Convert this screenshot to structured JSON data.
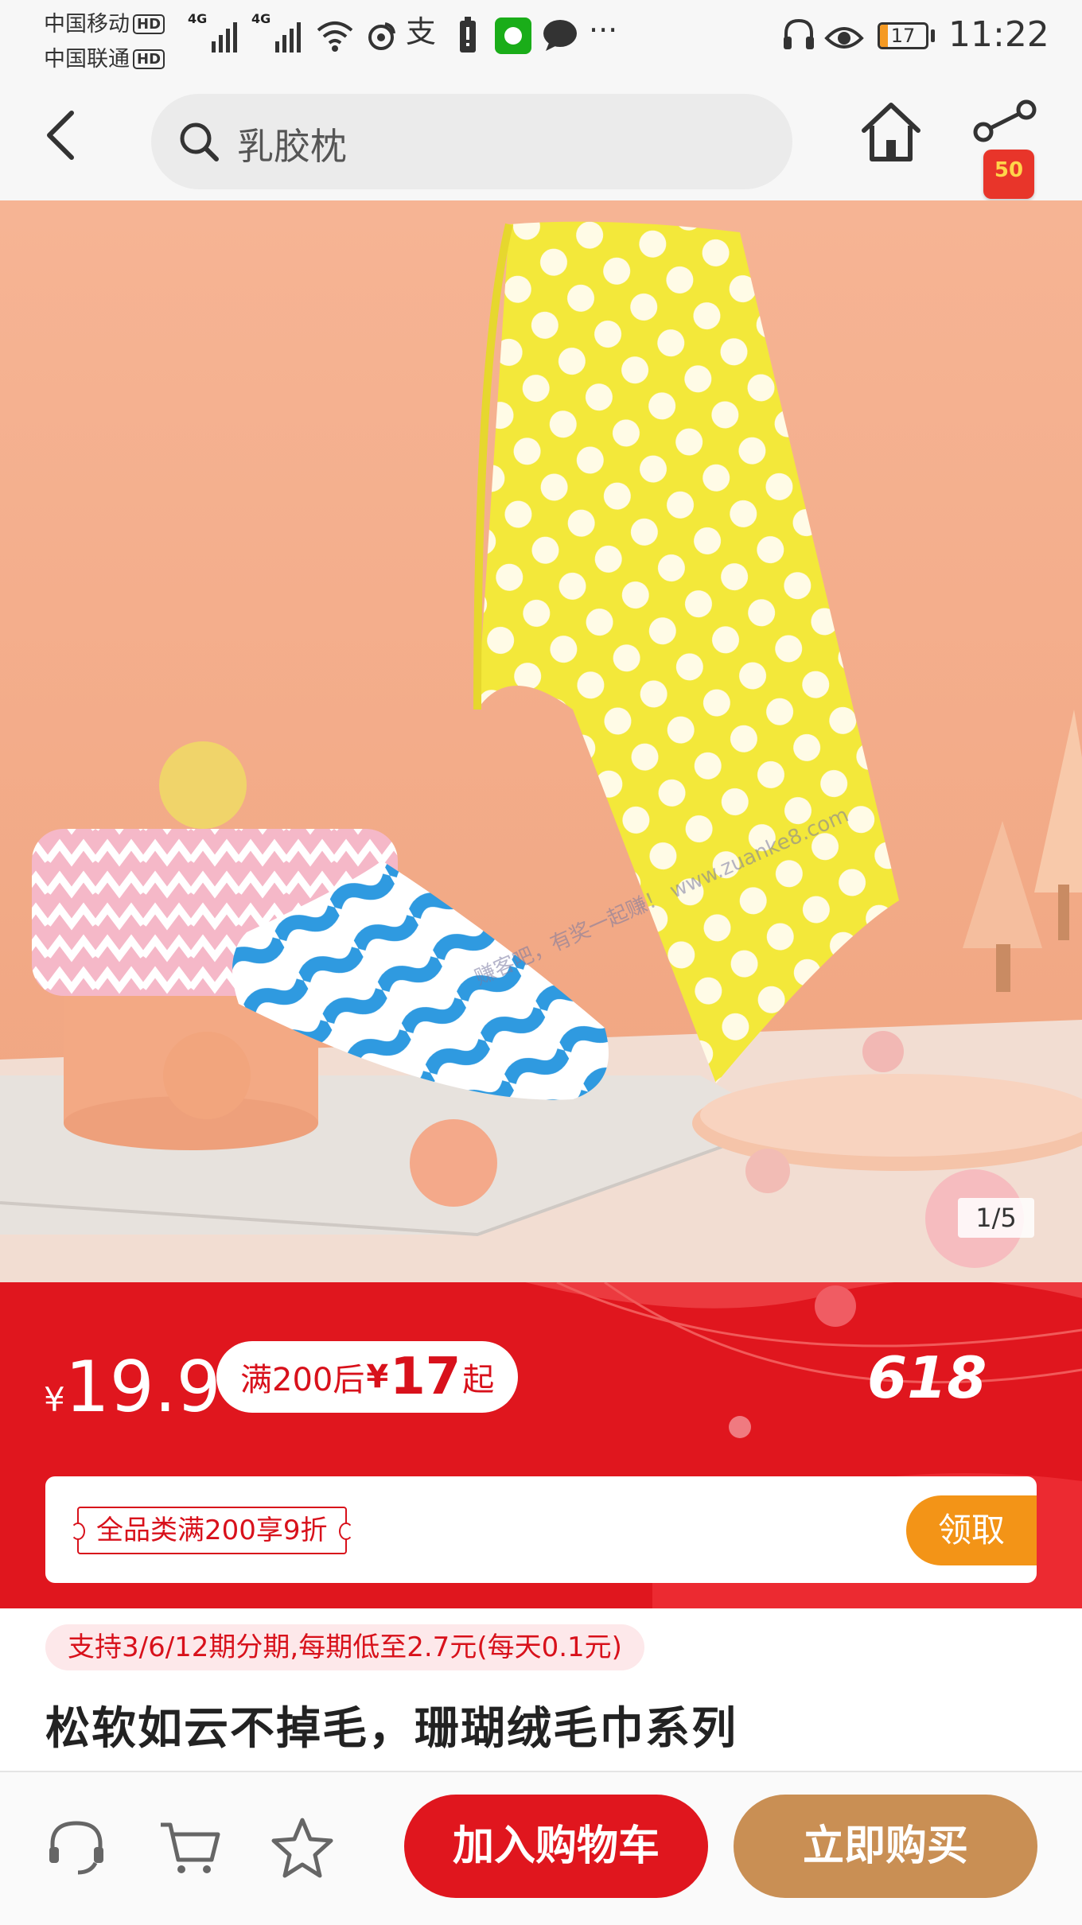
{
  "status_bar": {
    "carrier_1": "中国移动",
    "carrier_2": "中国联通",
    "hd_badge": "HD",
    "network_label": "4G",
    "battery_level": "17",
    "time": "11:22"
  },
  "nav": {
    "search_text": "乳胶枕",
    "coupon_badge": "50"
  },
  "product_image": {
    "counter": "1/5",
    "watermark": "赚客吧，有奖一起赚！ www.zuanke8.com"
  },
  "price": {
    "currency": "¥",
    "amount": "19.9",
    "deal_prefix": "满200后",
    "deal_currency": "¥",
    "deal_value": "17",
    "deal_suffix": "起",
    "promo": "618"
  },
  "coupon": {
    "tag": "全品类满200享9折",
    "claim_label": "领取"
  },
  "info": {
    "installment": "支持3/6/12期分期,每期低至2.7元(每天0.1元)",
    "title": "松软如云不掉毛，珊瑚绒毛巾系列"
  },
  "bottom_bar": {
    "add_cart_label": "加入购物车",
    "buy_now_label": "立即购买"
  },
  "colors": {
    "brand_red": "#e0161e",
    "buy_now": "#c98f54",
    "claim_orange": "#f39417",
    "installment_bg": "#fde8ea"
  }
}
